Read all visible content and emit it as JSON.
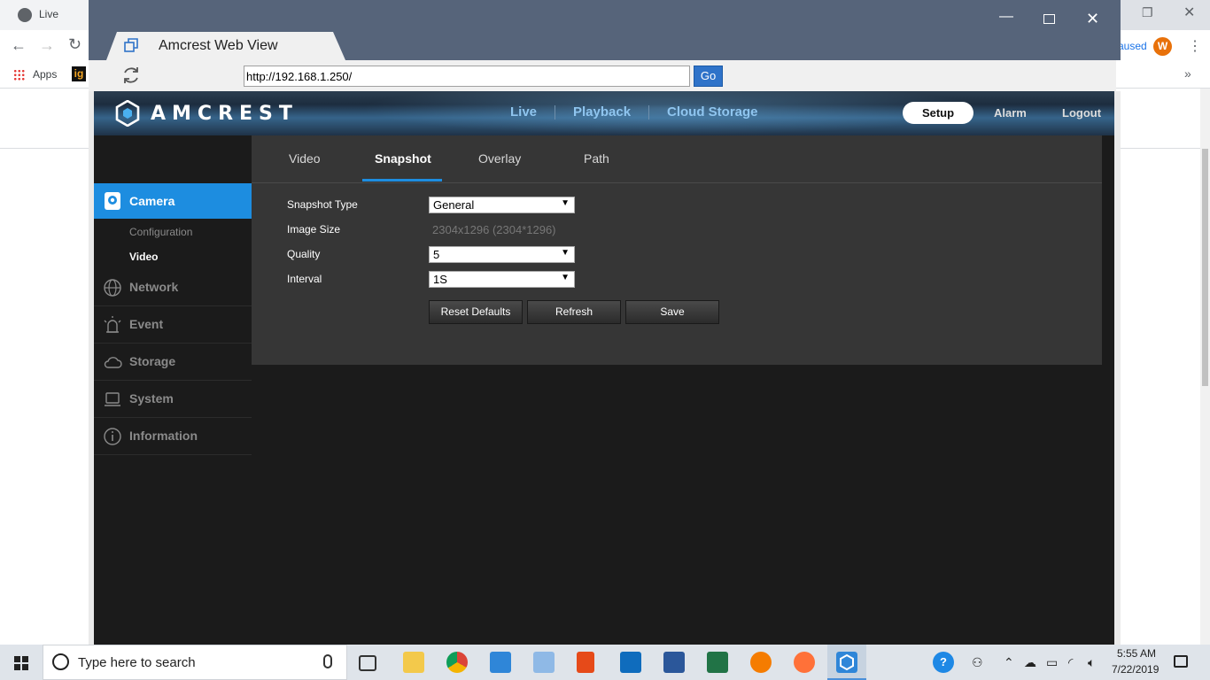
{
  "background_browser": {
    "tab_title": "Live",
    "profile_status": "aused",
    "profile_initial": "W",
    "bookmark_apps": "Apps",
    "bookmark_ig": "ig"
  },
  "app_window": {
    "tab_title": "Amcrest Web View",
    "url": "http://192.168.1.250/",
    "go_label": "Go"
  },
  "header": {
    "brand": "AMCREST",
    "nav": [
      "Live",
      "Playback",
      "Cloud Storage"
    ],
    "setup": "Setup",
    "alarm": "Alarm",
    "logout": "Logout"
  },
  "sidebar": {
    "camera": "Camera",
    "camera_sub": [
      "Configuration",
      "Video"
    ],
    "items": [
      "Network",
      "Event",
      "Storage",
      "System",
      "Information"
    ]
  },
  "tabs": [
    "Video",
    "Snapshot",
    "Overlay",
    "Path"
  ],
  "active_tab": "Snapshot",
  "form": {
    "snapshot_type_label": "Snapshot Type",
    "snapshot_type_value": "General",
    "image_size_label": "Image Size",
    "image_size_value": "2304x1296 (2304*1296)",
    "quality_label": "Quality",
    "quality_value": "5",
    "interval_label": "Interval",
    "interval_value": "1S"
  },
  "buttons": {
    "reset": "Reset Defaults",
    "refresh": "Refresh",
    "save": "Save"
  },
  "taskbar": {
    "search_placeholder": "Type here to search",
    "time": "5:55 AM",
    "date": "7/22/2019"
  },
  "colors": {
    "accent": "#1d8de0",
    "header_nav": "#8fc5ef",
    "panel": "#363636",
    "app_bg": "#1b1b1b"
  }
}
